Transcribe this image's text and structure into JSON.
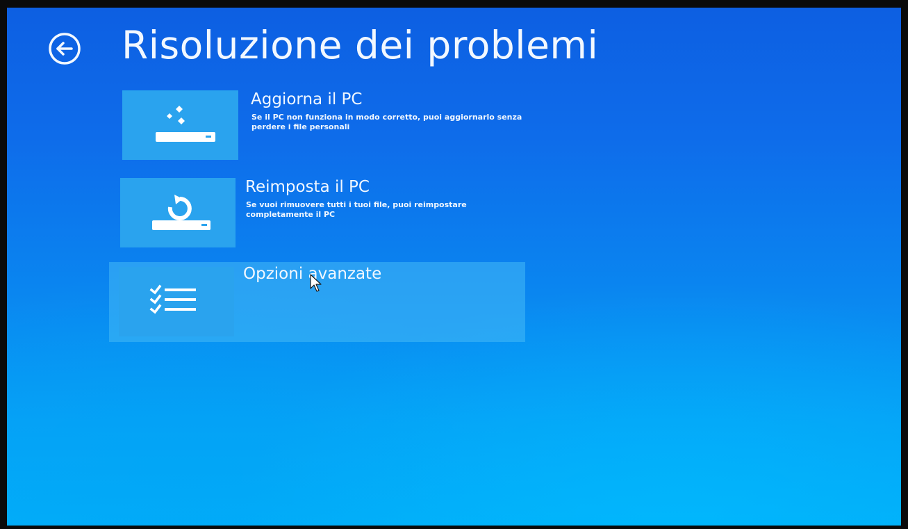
{
  "page": {
    "title": "Risoluzione dei problemi",
    "back_icon": "back-arrow-circle-icon"
  },
  "options": [
    {
      "title": "Aggiorna il PC",
      "description": "Se il PC non funziona in modo corretto, puoi aggiornarlo senza perdere i file personali",
      "icon": "refresh-pc-icon"
    },
    {
      "title": "Reimposta il PC",
      "description": "Se vuoi rimuovere tutti i tuoi file, puoi reimpostare completamente il PC",
      "icon": "reset-pc-icon"
    },
    {
      "title": "Opzioni avanzate",
      "description": "",
      "icon": "checklist-icon",
      "highlighted": true
    }
  ],
  "colors": {
    "background_top": "#0d5fe2",
    "background_bottom": "#02aef9",
    "tile": "#2aa3ee",
    "highlight": "#46b9f5",
    "text": "#f2f8ff"
  }
}
